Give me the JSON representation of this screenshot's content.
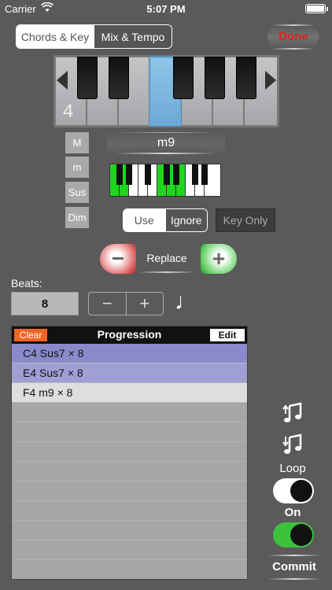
{
  "status_bar": {
    "carrier": "Carrier",
    "time": "5:07 PM"
  },
  "tabs": {
    "chords_key": "Chords & Key",
    "mix_tempo": "Mix & Tempo",
    "selected": "Chords & Key"
  },
  "done_label": "Done",
  "piano": {
    "octave": "4",
    "highlighted_key": "C"
  },
  "quality_buttons": [
    "M",
    "m",
    "Sus",
    "Dim"
  ],
  "chord_name": "m9",
  "mini_keyboard": {
    "highlighted": "green"
  },
  "use_ignore": {
    "use": "Use",
    "ignore": "Ignore",
    "selected": "Ignore"
  },
  "key_only": "Key Only",
  "replace": {
    "minus": "−",
    "label": "Replace",
    "plus": "+"
  },
  "beats": {
    "label": "Beats:",
    "value": "8",
    "minus": "−",
    "plus": "+",
    "note_icon": "♩"
  },
  "progression": {
    "clear": "Clear",
    "title": "Progression",
    "edit": "Edit",
    "rows": [
      "C4 Sus7 × 8",
      "E4 Sus7 × 8",
      "F4 m9 × 8"
    ]
  },
  "right_panel": {
    "icon1": "music-notes-up-icon",
    "icon2": "music-notes-down-icon",
    "loop_label": "Loop",
    "loop_on": false,
    "on_label": "On",
    "on_on": true,
    "commit": "Commit"
  },
  "colors": {
    "background": "#5a5a5a",
    "clear": "#f26522",
    "done": "#e02020",
    "toggle_on": "#3cc23c",
    "row1": "#8a8acb",
    "row2": "#9f9fd6"
  }
}
